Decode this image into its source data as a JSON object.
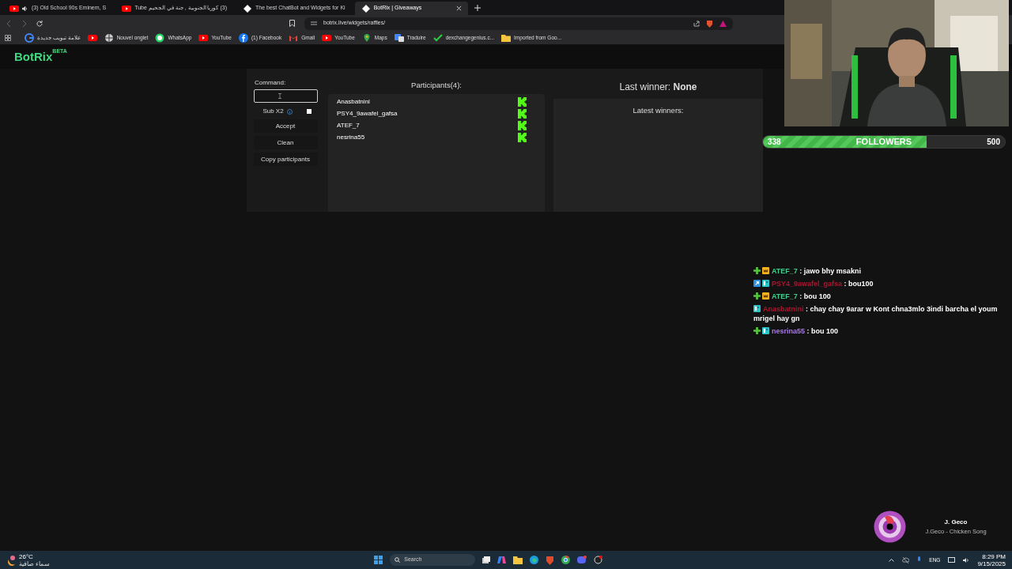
{
  "browser": {
    "tabs": [
      {
        "title": "(3) Old School 90s  Eminem, S",
        "selected": false,
        "kind": "youtube",
        "audio": true
      },
      {
        "title": "(3) كوريا الجنوبية , جنة في الجحيم Tube",
        "selected": false,
        "kind": "youtube",
        "audio": false
      },
      {
        "title": "The best ChatBot and Widgets for Ki",
        "selected": false,
        "kind": "diamond",
        "audio": false
      },
      {
        "title": "BotRix | Giveaways",
        "selected": true,
        "kind": "diamond",
        "audio": false
      }
    ],
    "address": "botrix.live/widgets/raffles/",
    "bookmarks": [
      {
        "label": "علامة تبويب جديدة",
        "kind": "google"
      },
      {
        "kind": "youtube"
      },
      {
        "label": "Nouvel onglet",
        "kind": "globe"
      },
      {
        "label": "WhatsApp",
        "kind": "whatsapp"
      },
      {
        "label": "YouTube",
        "kind": "youtube"
      },
      {
        "label": "(1) Facebook",
        "kind": "facebook"
      },
      {
        "label": "Gmail",
        "kind": "gmail"
      },
      {
        "label": "YouTube",
        "kind": "youtube"
      },
      {
        "label": "Maps",
        "kind": "maps"
      },
      {
        "label": "Traduire",
        "kind": "translate"
      },
      {
        "label": "dexchangegenius.c...",
        "kind": "check"
      },
      {
        "label": "Imported from Goo...",
        "kind": "folder"
      }
    ]
  },
  "site": {
    "logo": "BotRix",
    "logo_badge": "BETA"
  },
  "raffle": {
    "command_label": "Command:",
    "sub_x2": {
      "label": "Sub X2",
      "checked": false
    },
    "buttons": [
      "Accept",
      "Clean",
      "Copy participants"
    ],
    "participants_title": "Participants(4):",
    "participants": [
      {
        "name": "Anasbatnini"
      },
      {
        "name": "PSY4_9awafel_gafsa"
      },
      {
        "name": "ATEF_7"
      },
      {
        "name": "nesrina55"
      }
    ],
    "last_winner": "Last winner: **None**",
    "latest_winners_title": "Latest winners:"
  },
  "followers_goal": {
    "current": "338",
    "label": "FOLLOWERS",
    "goal": "500",
    "level": 0.676
  },
  "chat": [
    {
      "badges": [
        {
          "kind": "plus"
        },
        {
          "kind": "crown"
        }
      ],
      "user": "ATEF_7",
      "color": "#3fcf8e",
      "text": ": jawo bhy msakni"
    },
    {
      "badges": [
        {
          "kind": "arrow"
        },
        {
          "kind": "gift"
        }
      ],
      "user": "PSY4_9awafel_gafsa",
      "color": "#b0142e",
      "text": ": bou100"
    },
    {
      "badges": [
        {
          "kind": "plus"
        },
        {
          "kind": "crown"
        }
      ],
      "user": "ATEF_7",
      "color": "#3fcf8e",
      "text": ": bou 100"
    },
    {
      "badges": [
        {
          "kind": "gift"
        }
      ],
      "user": "Anasbatnini",
      "color": "#b0142e",
      "text": ": chay chay 9arar w Kont chna3mlo 3indi barcha el youm mrigel hay gn"
    },
    {
      "badges": [
        {
          "kind": "plus"
        },
        {
          "kind": "gift"
        }
      ],
      "user": "nesrina55",
      "color": "#a77be0",
      "text": ": bou 100"
    }
  ],
  "now_playing": {
    "artist": "J. Geco",
    "track": "J.Geco - Chicken Song"
  },
  "taskbar": {
    "temperature": "26°C",
    "weather": "سماء صافية",
    "search_placeholder": "Search",
    "language": "ENG",
    "time": "8:29 PM",
    "date": "9/15/2025"
  }
}
